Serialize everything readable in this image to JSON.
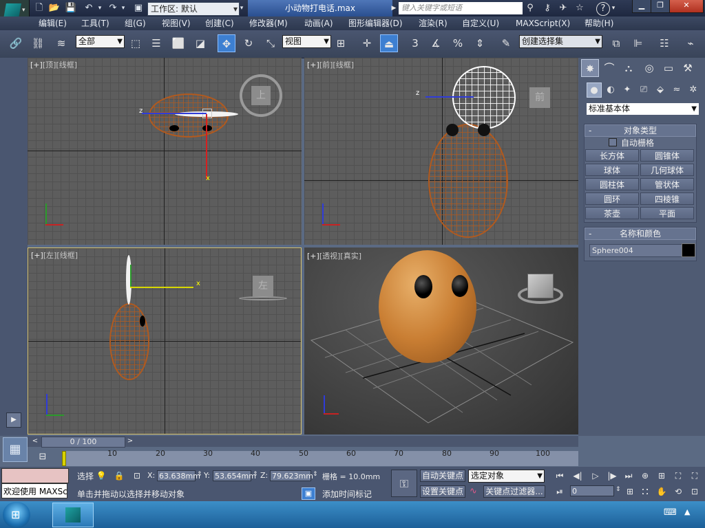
{
  "titlebar": {
    "workspace": "工作区: 默认",
    "file_title": "小动物打电话.max",
    "search_placeholder": "键入关键字或短语",
    "help": "?"
  },
  "menu": [
    "编辑(E)",
    "工具(T)",
    "组(G)",
    "视图(V)",
    "创建(C)",
    "修改器(M)",
    "动画(A)",
    "图形编辑器(D)",
    "渲染(R)",
    "自定义(U)",
    "MAXScript(X)",
    "帮助(H)"
  ],
  "toolbar": {
    "selection_filter": "全部",
    "reference_coord": "视图",
    "named_selection": "创建选择集",
    "snap_labels": [
      "3",
      "%"
    ]
  },
  "viewports": {
    "top": {
      "label_plus": "[+]",
      "label_view": "[顶]",
      "label_mode": "[线框]",
      "cube": "上"
    },
    "front": {
      "label_plus": "[+]",
      "label_view": "[前]",
      "label_mode": "[线框]",
      "cube": "前"
    },
    "left": {
      "label_plus": "[+]",
      "label_view": "[左]",
      "label_mode": "[线框]",
      "cube": "左"
    },
    "perspective": {
      "label_plus": "[+]",
      "label_view": "[透视]",
      "label_mode": "[真实]"
    },
    "axis_labels": {
      "x": "x",
      "y": "y",
      "z": "z"
    }
  },
  "command_panel": {
    "category": "标准基本体",
    "object_type": {
      "title": "对象类型",
      "autogrid": "自动栅格",
      "buttons": [
        "长方体",
        "圆锥体",
        "球体",
        "几何球体",
        "圆柱体",
        "管状体",
        "圆环",
        "四棱锥",
        "茶壶",
        "平面"
      ]
    },
    "name_color": {
      "title": "名称和颜色",
      "name": "Sphere004",
      "color": "#000000"
    }
  },
  "timeline": {
    "slider": "0 / 100",
    "ticks": [
      "10",
      "20",
      "30",
      "40",
      "50",
      "60",
      "70",
      "80",
      "90",
      "100"
    ]
  },
  "status": {
    "welcome": "欢迎使用 MAXSc",
    "selected_label": "选择",
    "x_label": "X:",
    "x": "63.638mm",
    "y_label": "Y:",
    "y": "53.654mm",
    "z_label": "Z:",
    "z": "79.623mm",
    "grid": "栅格 = 10.0mm",
    "prompt": "单击并拖动以选择并移动对象",
    "add_time_tag": "添加时间标记",
    "auto_key": "自动关键点",
    "set_key": "设置关键点",
    "key_mode": "选定对象",
    "key_filters": "关键点过滤器...",
    "frame": "0"
  }
}
